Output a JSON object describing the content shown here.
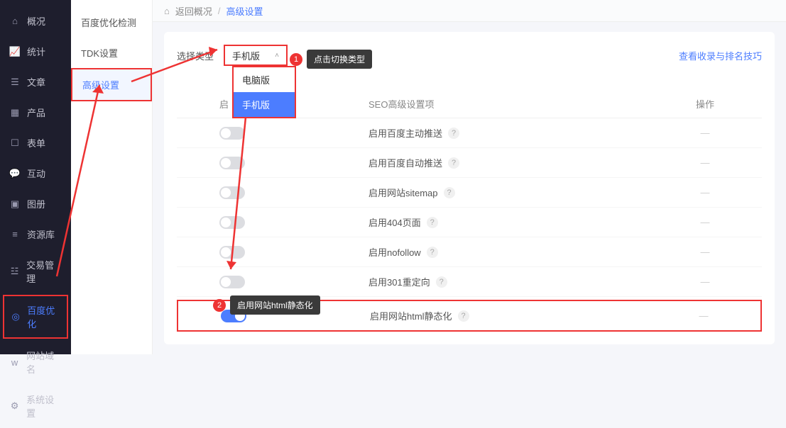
{
  "sidebar": {
    "items": [
      {
        "icon": "home",
        "label": "概况"
      },
      {
        "icon": "chart",
        "label": "统计"
      },
      {
        "icon": "doc",
        "label": "文章"
      },
      {
        "icon": "grid",
        "label": "产品"
      },
      {
        "icon": "form",
        "label": "表单"
      },
      {
        "icon": "chat",
        "label": "互动"
      },
      {
        "icon": "image",
        "label": "图册"
      },
      {
        "icon": "db",
        "label": "资源库"
      },
      {
        "icon": "trade",
        "label": "交易管理"
      },
      {
        "icon": "baidu",
        "label": "百度优化"
      },
      {
        "icon": "domain",
        "label": "网站域名"
      },
      {
        "icon": "gear",
        "label": "系统设置"
      }
    ]
  },
  "subnav": {
    "items": [
      {
        "label": "百度优化检测"
      },
      {
        "label": "TDK设置"
      },
      {
        "label": "高级设置"
      }
    ]
  },
  "breadcrumb": {
    "back": "返回概况",
    "current": "高级设置",
    "sep": "/"
  },
  "panel": {
    "select_label": "选择类型",
    "select_value": "手机版",
    "dropdown": {
      "opt_pc": "电脑版",
      "opt_mobile": "手机版"
    },
    "tip_link": "查看收录与排名技巧",
    "thead": {
      "toggle": "启",
      "label": "SEO高级设置项",
      "action": "操作"
    },
    "rows": [
      {
        "label": "启用百度主动推送",
        "on": false
      },
      {
        "label": "启用百度自动推送",
        "on": false
      },
      {
        "label": "启用网站sitemap",
        "on": false
      },
      {
        "label": "启用404页面",
        "on": false
      },
      {
        "label": "启用nofollow",
        "on": false
      },
      {
        "label": "启用301重定向",
        "on": false
      },
      {
        "label": "启用网站html静态化",
        "on": true
      }
    ],
    "action_dash": "—"
  },
  "callouts": {
    "c1_num": "1",
    "c1_txt": "点击切换类型",
    "c2_num": "2",
    "c2_txt": "启用网站html静态化"
  }
}
